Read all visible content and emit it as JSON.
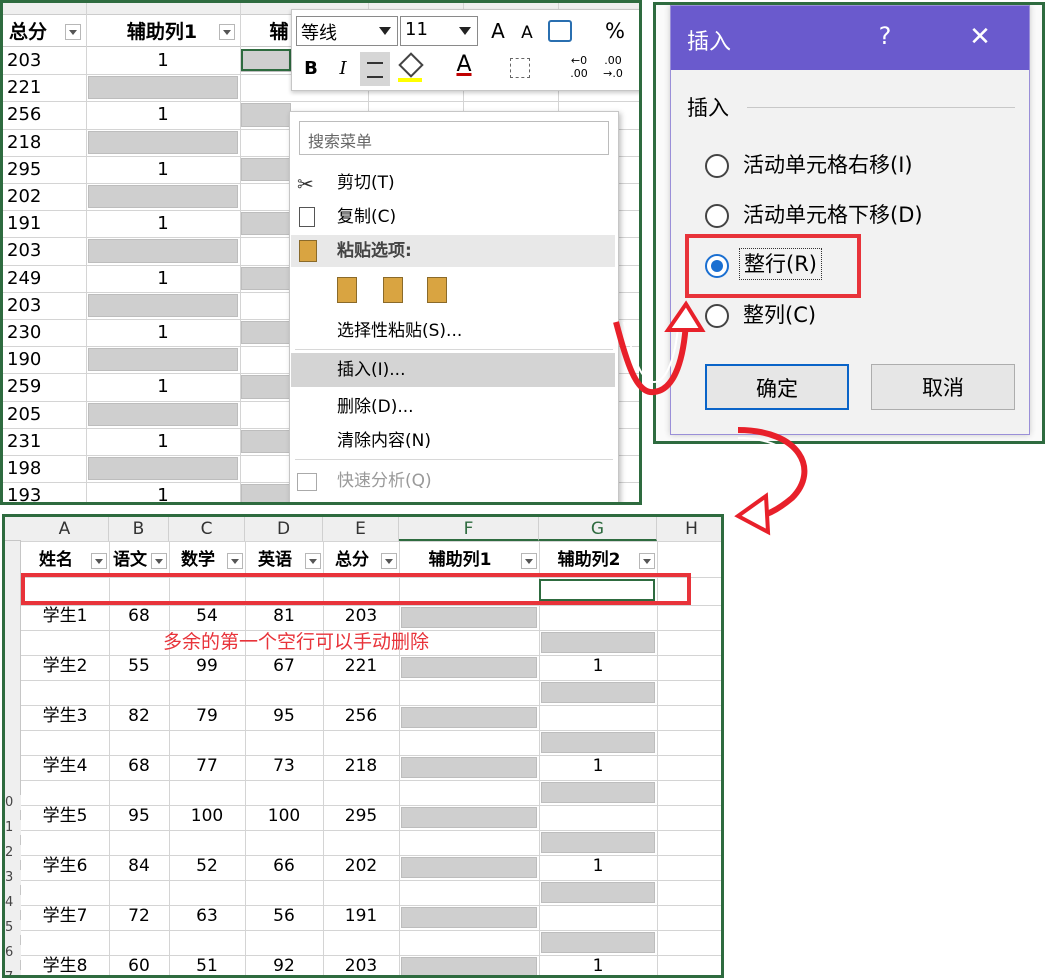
{
  "top_sheet": {
    "headers": [
      "总分",
      "辅助列1",
      "辅"
    ],
    "rows": [
      {
        "total": "203",
        "aux1": "1"
      },
      {
        "total": "221",
        "aux1": ""
      },
      {
        "total": "256",
        "aux1": "1"
      },
      {
        "total": "218",
        "aux1": ""
      },
      {
        "total": "295",
        "aux1": "1"
      },
      {
        "total": "202",
        "aux1": ""
      },
      {
        "total": "191",
        "aux1": "1"
      },
      {
        "total": "203",
        "aux1": ""
      },
      {
        "total": "249",
        "aux1": "1"
      },
      {
        "total": "203",
        "aux1": ""
      },
      {
        "total": "230",
        "aux1": "1"
      },
      {
        "total": "190",
        "aux1": ""
      },
      {
        "total": "259",
        "aux1": "1"
      },
      {
        "total": "205",
        "aux1": ""
      },
      {
        "total": "231",
        "aux1": "1"
      },
      {
        "total": "198",
        "aux1": ""
      },
      {
        "total": "193",
        "aux1": "1"
      }
    ]
  },
  "mini_toolbar": {
    "font_name": "等线",
    "font_size": "11",
    "grow_font": "A",
    "shrink_font": "A",
    "percent": "%",
    "bold": "B",
    "italic": "I",
    "font_color_letter": "A",
    "inc_decimal_a": "←0",
    "inc_decimal_b": ".00",
    "dec_decimal_a": ".00",
    "dec_decimal_b": "→.0"
  },
  "context_menu": {
    "search_placeholder": "搜索菜单",
    "cut": "剪切(T)",
    "copy": "复制(C)",
    "paste_options": "粘贴选项:",
    "paste_special": "选择性粘贴(S)...",
    "insert": "插入(I)...",
    "delete": "删除(D)...",
    "clear": "清除内容(N)",
    "quick_analysis": "快速分析(Q)"
  },
  "dialog": {
    "title": "插入",
    "help": "?",
    "close": "✕",
    "group_label": "插入",
    "options": [
      {
        "label": "活动单元格右移(I)",
        "selected": false
      },
      {
        "label": "活动单元格下移(D)",
        "selected": false
      },
      {
        "label": "整行(R)",
        "selected": true
      },
      {
        "label": "整列(C)",
        "selected": false
      }
    ],
    "ok": "确定",
    "cancel": "取消"
  },
  "bottom_sheet": {
    "col_letters": [
      "A",
      "B",
      "C",
      "D",
      "E",
      "F",
      "G",
      "H"
    ],
    "headers": [
      "姓名",
      "语文",
      "数学",
      "英语",
      "总分",
      "辅助列1",
      "辅助列2"
    ],
    "annotation": "多余的第一个空行可以手动删除",
    "row_numbers": [
      "0",
      "1",
      "2",
      "3",
      "4",
      "5",
      "6",
      "7"
    ],
    "students": [
      {
        "name": "学生1",
        "chinese": "68",
        "math": "54",
        "english": "81",
        "total": "203",
        "aux2": ""
      },
      {
        "name": "学生2",
        "chinese": "55",
        "math": "99",
        "english": "67",
        "total": "221",
        "aux2": "1"
      },
      {
        "name": "学生3",
        "chinese": "82",
        "math": "79",
        "english": "95",
        "total": "256",
        "aux2": ""
      },
      {
        "name": "学生4",
        "chinese": "68",
        "math": "77",
        "english": "73",
        "total": "218",
        "aux2": "1"
      },
      {
        "name": "学生5",
        "chinese": "95",
        "math": "100",
        "english": "100",
        "total": "295",
        "aux2": ""
      },
      {
        "name": "学生6",
        "chinese": "84",
        "math": "52",
        "english": "66",
        "total": "202",
        "aux2": "1"
      },
      {
        "name": "学生7",
        "chinese": "72",
        "math": "63",
        "english": "56",
        "total": "191",
        "aux2": ""
      },
      {
        "name": "学生8",
        "chinese": "60",
        "math": "51",
        "english": "92",
        "total": "203",
        "aux2": "1"
      }
    ]
  },
  "colors": {
    "panel_border": "#2e6b3f",
    "highlight_red": "#e8333a",
    "dialog_title_bar": "#6a5acd",
    "annotation_text": "#e8333a"
  }
}
